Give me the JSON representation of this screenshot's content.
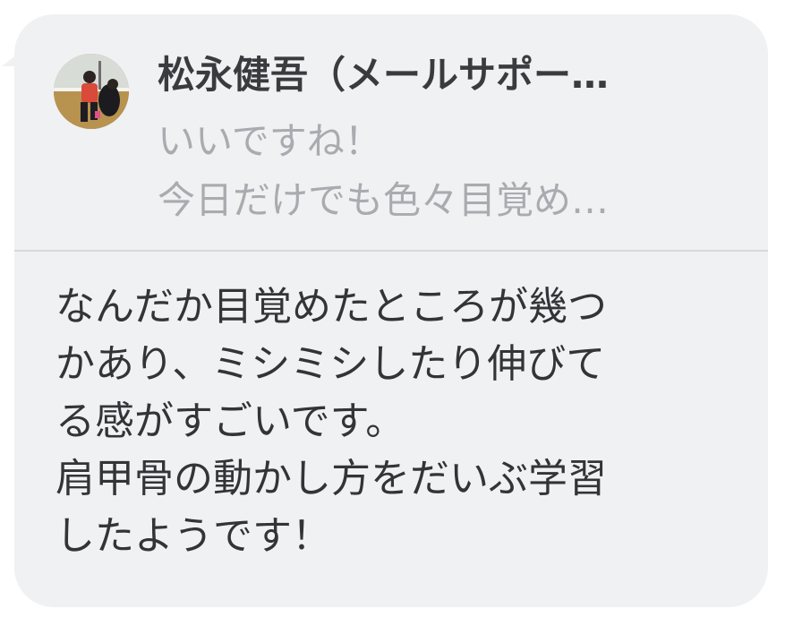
{
  "reply": {
    "sender_name": "松永健吾（メールサポー…",
    "quoted_lines": [
      "いいですね！",
      "今日だけでも色々目覚め…"
    ],
    "avatar_icon": "user-photo-avatar"
  },
  "message": {
    "lines": [
      "なんだか目覚めたところが幾つ",
      "かあり、ミシミシしたり伸びて",
      "る感がすごいです。",
      "肩甲骨の動かし方をだいぶ学習",
      "したようです！"
    ]
  },
  "colors": {
    "bubble_bg": "#f0f1f3",
    "sender_text": "#3a3b3f",
    "quoted_text": "#a9abb0",
    "body_text": "#333438",
    "divider": "#d6d8dc"
  }
}
